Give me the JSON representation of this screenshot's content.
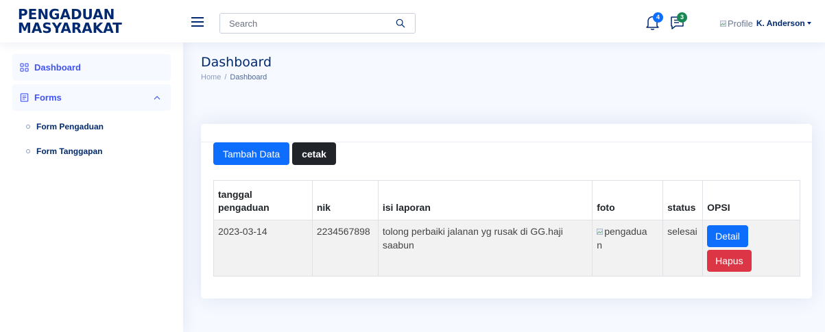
{
  "header": {
    "logo_line1": "PENGADUAN",
    "logo_line2": "MASYARAKAT",
    "search_placeholder": "Search",
    "notification_count": "4",
    "message_count": "3",
    "profile_alt": "Profile",
    "profile_name": "K. Anderson",
    "icons": {
      "menu": "hamburger-icon",
      "search": "search-icon",
      "notifications": "bell-icon",
      "messages": "chat-icon"
    }
  },
  "sidebar": {
    "items": [
      {
        "label": "Dashboard",
        "icon": "grid-icon"
      },
      {
        "label": "Forms",
        "icon": "journal-text-icon"
      }
    ],
    "subitems": [
      {
        "label": "Form Pengaduan"
      },
      {
        "label": "Form Tanggapan"
      }
    ]
  },
  "main": {
    "title": "Dashboard",
    "breadcrumb": {
      "home": "Home",
      "separator": "/",
      "current": "Dashboard"
    },
    "buttons": {
      "add": "Tambah Data",
      "print": "cetak"
    },
    "table": {
      "headers": {
        "tanggal_line1": "tanggal",
        "tanggal_line2": "pengaduan",
        "nik": "nik",
        "isi": "isi laporan",
        "foto": "foto",
        "status": "status",
        "opsi": "OPSI"
      },
      "rows": [
        {
          "tanggal": "2023-03-14",
          "nik": "2234567898",
          "isi": "tolong perbaiki jalanan yg rusak di GG.haji saabun",
          "foto_alt_line1": "pengadua",
          "foto_alt_line2": "n",
          "status": "selesai",
          "detail_label": "Detail",
          "hapus_label": "Hapus"
        }
      ]
    }
  },
  "colors": {
    "brand": "#012970",
    "accent": "#4154f1",
    "primary": "#0d6efd",
    "danger": "#dc3545",
    "dark": "#212529",
    "badge_green": "#198754"
  }
}
